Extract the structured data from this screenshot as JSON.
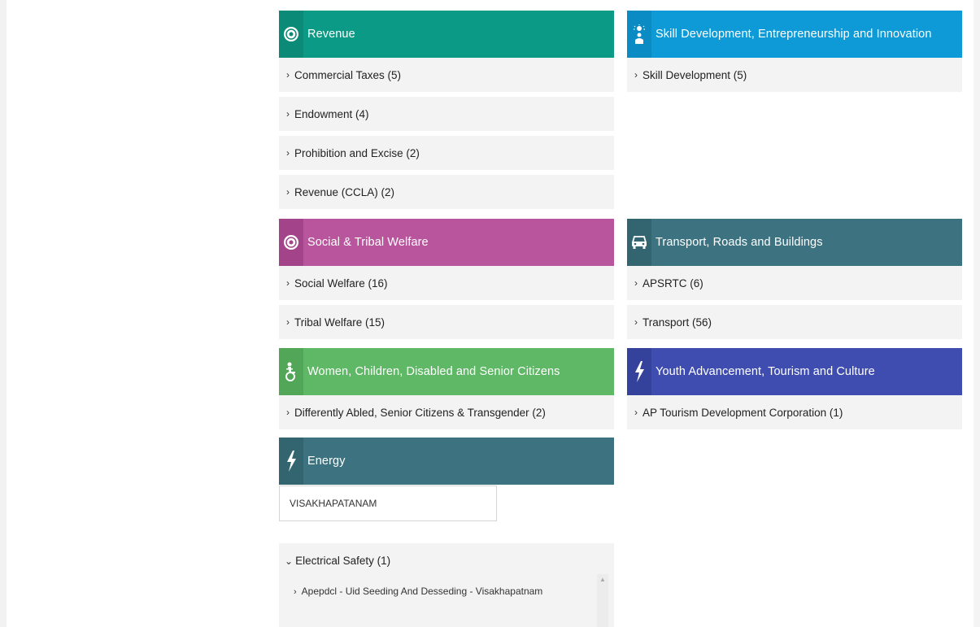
{
  "sections": {
    "revenue": {
      "title": "Revenue",
      "color": "#0a9a85",
      "icon_bg": "#0a8a77",
      "icon": "emblem-icon",
      "items": [
        "Commercial Taxes (5)",
        "Endowment (4)",
        "Prohibition and Excise (2)",
        "Revenue (CCLA) (2)"
      ]
    },
    "skill": {
      "title": "Skill Development, Entrepreneurship and Innovation",
      "color": "#0d9ad7",
      "icon_bg": "#0a8bc4",
      "icon": "idea-person-icon",
      "items": [
        "Skill Development (5)"
      ]
    },
    "social": {
      "title": "Social & Tribal Welfare",
      "color": "#b8559c",
      "icon_bg": "#a3448a",
      "icon": "emblem-icon",
      "items": [
        "Social Welfare (16)",
        "Tribal Welfare (15)"
      ]
    },
    "transport": {
      "title": "Transport, Roads and Buildings",
      "color": "#3d7380",
      "icon_bg": "#336570",
      "icon": "car-icon",
      "items": [
        "APSRTC (6)",
        "Transport (56)"
      ]
    },
    "women": {
      "title": "Women, Children, Disabled and Senior Citizens",
      "color": "#5fb865",
      "icon_bg": "#52a657",
      "icon": "wheelchair-icon",
      "items": [
        "Differently Abled, Senior Citizens & Transgender (2)"
      ]
    },
    "youth": {
      "title": "Youth Advancement, Tourism and Culture",
      "color": "#3f4db0",
      "icon_bg": "#35429c",
      "icon": "lightning-icon",
      "items": [
        "AP Tourism Development Corporation (1)"
      ]
    },
    "energy": {
      "title": "Energy",
      "color": "#3d7380",
      "icon_bg": "#336570",
      "icon": "lightning-icon"
    }
  },
  "energy_detail": {
    "city": "VISAKHAPATANAM",
    "expanded_item": "Electrical Safety (1)",
    "sub_item": "Apepdcl - Uid Seeding And Desseding - Visakhapatnam"
  },
  "glyphs": {
    "chevron_right": "›",
    "chevron_down": "⌄",
    "scroll_up": "▲"
  }
}
